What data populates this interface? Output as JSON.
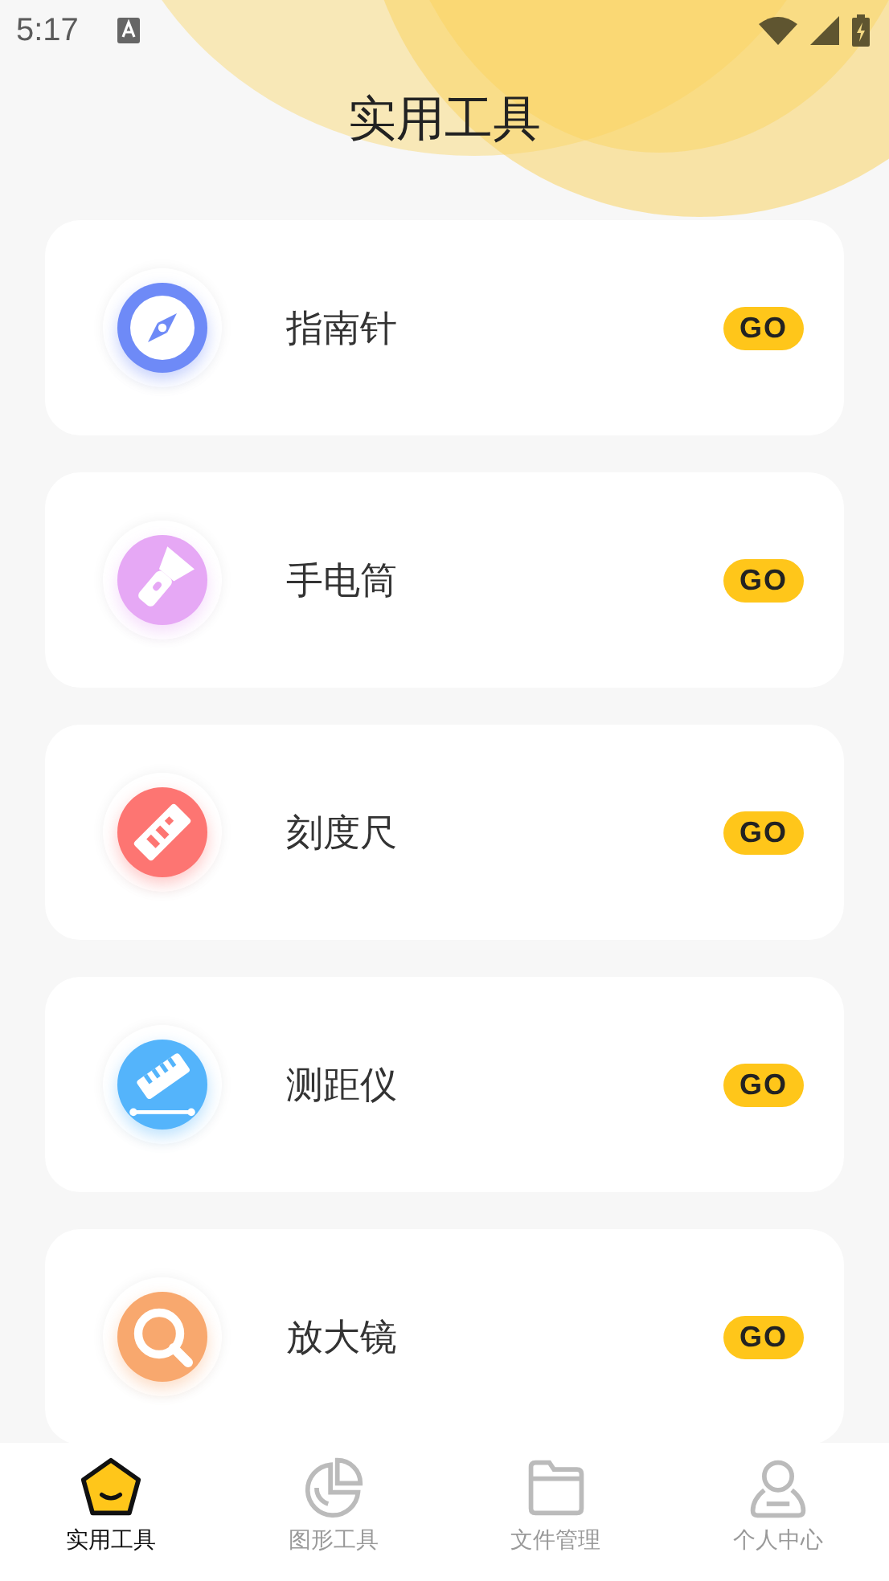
{
  "status_bar": {
    "time": "5:17"
  },
  "title": "实用工具",
  "tools": [
    {
      "kind": "compass",
      "name": "指南针",
      "action": "GO",
      "color": "#6e8af7"
    },
    {
      "kind": "flashlight",
      "name": "手电筒",
      "action": "GO",
      "color": "#e6a8f5"
    },
    {
      "kind": "ruler",
      "name": "刻度尺",
      "action": "GO",
      "color": "#fd7572"
    },
    {
      "kind": "rangefinder",
      "name": "测距仪",
      "action": "GO",
      "color": "#54b4fb"
    },
    {
      "kind": "magnifier",
      "name": "放大镜",
      "action": "GO",
      "color": "#f8a86e"
    }
  ],
  "tabs": [
    {
      "kind": "tools",
      "label": "实用工具",
      "selected": true
    },
    {
      "kind": "chart",
      "label": "图形工具",
      "selected": false
    },
    {
      "kind": "folder",
      "label": "文件管理",
      "selected": false
    },
    {
      "kind": "person",
      "label": "个人中心",
      "selected": false
    }
  ]
}
